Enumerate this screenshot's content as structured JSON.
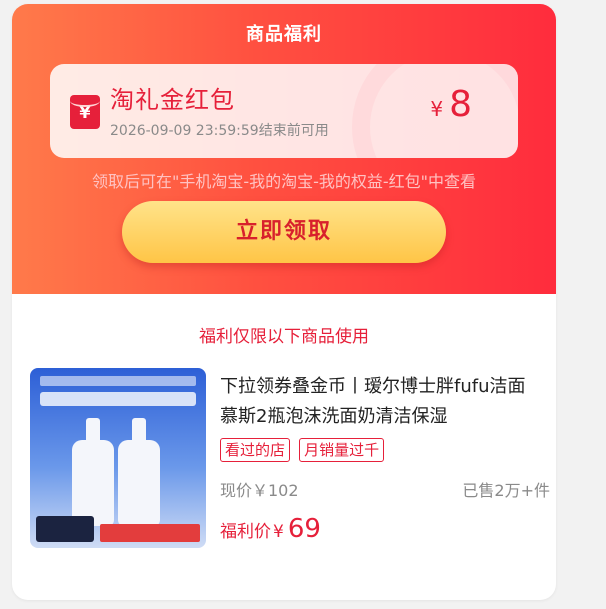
{
  "header": {
    "title": "商品福利"
  },
  "coupon": {
    "name": "淘礼金红包",
    "expire_text": "2026-09-09 23:59:59结束前可用",
    "currency": "¥",
    "amount": "8",
    "icon": "red-packet-icon",
    "icon_glyph": "¥"
  },
  "hint": "领取后可在\"手机淘宝-我的淘宝-我的权益-红包\"中查看",
  "claim_button": "立即领取",
  "section_title": "福利仅限以下商品使用",
  "product": {
    "title": "下拉领券叠金币丨瑷尔博士胖fufu洁面慕斯2瓶泡沫洗面奶清洁保湿",
    "tags": [
      "看过的店",
      "月销量过千"
    ],
    "current_price": "现价￥102",
    "sold": "已售2万+件",
    "welfare_label": "福利价",
    "welfare_currency": "¥",
    "welfare_price": "69"
  },
  "colors": {
    "accent": "#e6203a",
    "hero_start": "#ff7a4a",
    "hero_end": "#ff2c3d",
    "button_top": "#ffe38a",
    "button_bottom": "#ffc546"
  }
}
